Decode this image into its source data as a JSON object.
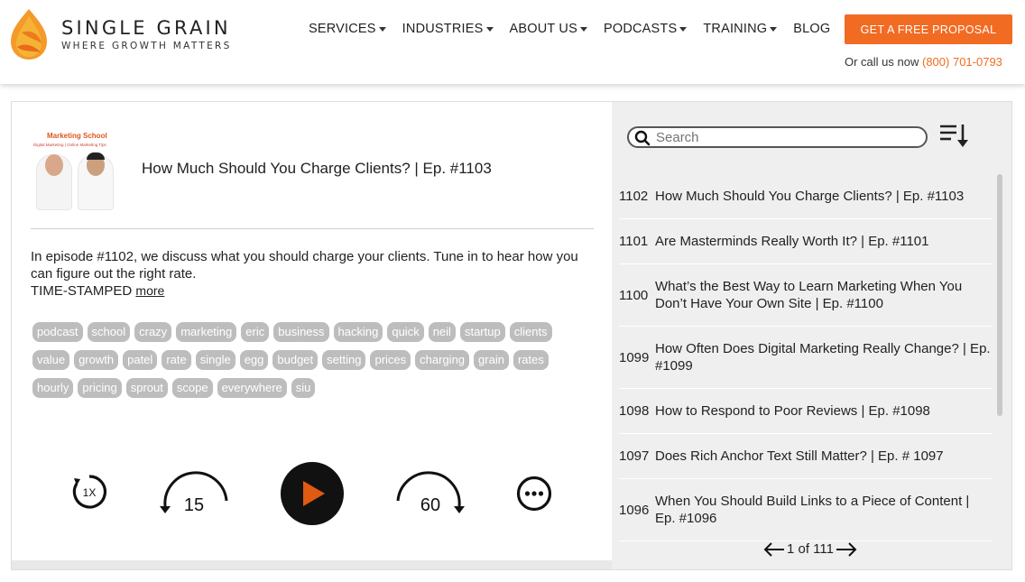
{
  "brand": {
    "name": "SINGLE GRAIN",
    "tagline": "WHERE GROWTH MATTERS",
    "colors": {
      "accent": "#f26b22",
      "logo_dark": "#f0842a",
      "logo_light": "#fbc040"
    }
  },
  "nav": {
    "items": [
      {
        "label": "SERVICES",
        "dropdown": true
      },
      {
        "label": "INDUSTRIES",
        "dropdown": true
      },
      {
        "label": "ABOUT US",
        "dropdown": true
      },
      {
        "label": "PODCASTS",
        "dropdown": true
      },
      {
        "label": "TRAINING",
        "dropdown": true
      },
      {
        "label": "BLOG",
        "dropdown": false
      }
    ],
    "cta_label": "GET A FREE PROPOSAL",
    "call_prefix": "Or call us now",
    "phone": "(800) 701-0793"
  },
  "episode": {
    "thumb_title": "Marketing School",
    "thumb_sub": "Digital Marketing | Online Marketing Tips",
    "title": "How Much Should You Charge Clients? | Ep. #1103",
    "description": "In episode #1102, we discuss what you should charge your clients. Tune in to hear how you can figure out the right rate.",
    "timestamp_label": "TIME-STAMPED",
    "more_label": "more",
    "tags": [
      "podcast",
      "school",
      "crazy",
      "marketing",
      "eric",
      "business",
      "hacking",
      "quick",
      "neil",
      "startup",
      "clients",
      "value",
      "growth",
      "patel",
      "rate",
      "single",
      "egg",
      "budget",
      "setting",
      "prices",
      "charging",
      "grain",
      "rates",
      "hourly",
      "pricing",
      "sprout",
      "scope",
      "everywhere",
      "siu"
    ]
  },
  "controls": {
    "speed_label": "1X",
    "rewind_label": "15",
    "forward_label": "60",
    "play_color": "#e05a12",
    "progress": 0
  },
  "playlist": {
    "search_placeholder": "Search",
    "items": [
      {
        "num": "1102",
        "title": "How Much Should You Charge Clients? | Ep. #1103"
      },
      {
        "num": "1101",
        "title": "Are Masterminds Really Worth It? | Ep. #1101"
      },
      {
        "num": "1100",
        "title": "What’s the Best Way to Learn Marketing When You Don’t Have Your Own Site | Ep. #1100"
      },
      {
        "num": "1099",
        "title": "How Often Does Digital Marketing Really Change? | Ep. #1099"
      },
      {
        "num": "1098",
        "title": "How to Respond to Poor Reviews | Ep. #1098"
      },
      {
        "num": "1097",
        "title": "Does Rich Anchor Text Still Matter? | Ep. # 1097"
      },
      {
        "num": "1096",
        "title": "When You Should Build Links to a Piece of Content | Ep. #1096"
      }
    ],
    "page_label": "1 of 111"
  }
}
